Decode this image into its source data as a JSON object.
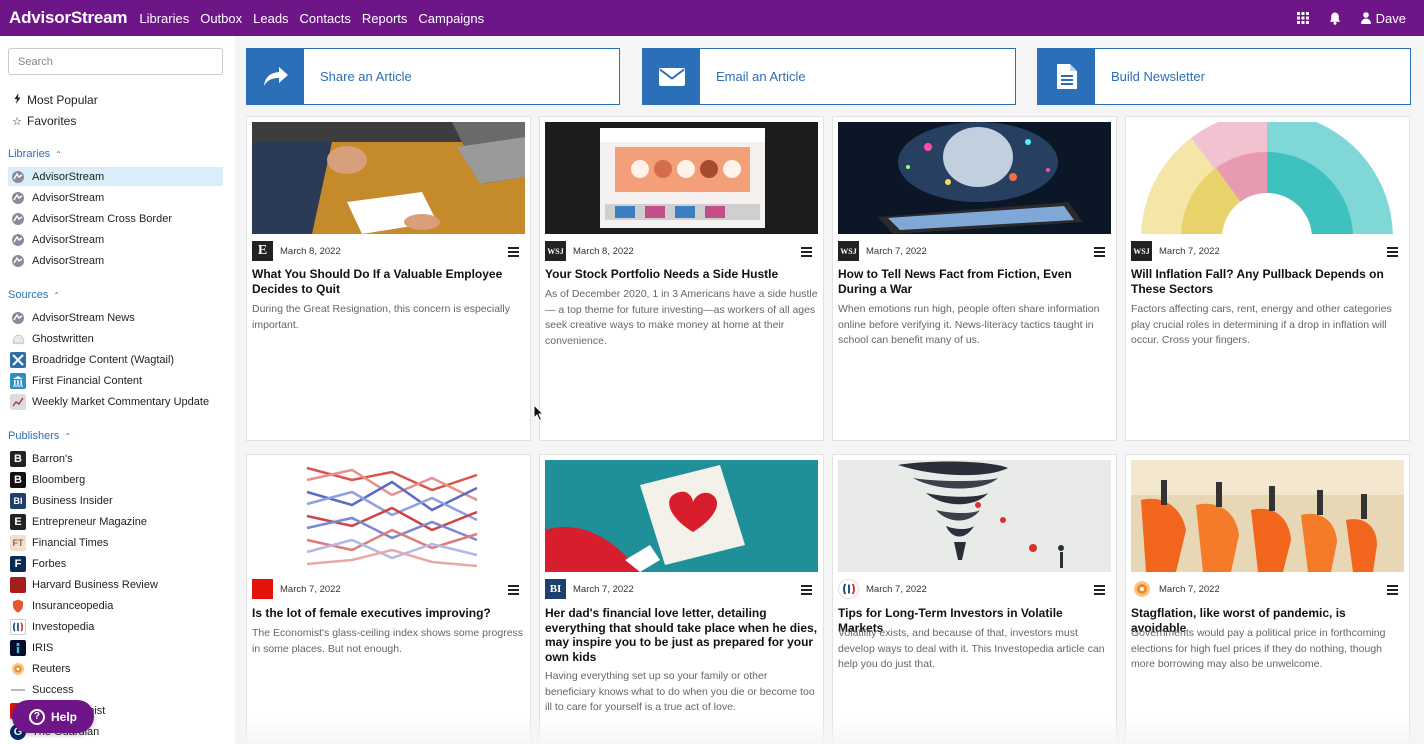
{
  "nav": {
    "brand": "AdvisorStream",
    "links": [
      "Libraries",
      "Outbox",
      "Leads",
      "Contacts",
      "Reports",
      "Campaigns"
    ],
    "user": "Dave"
  },
  "sidebar": {
    "search_placeholder": "Search",
    "quick": [
      {
        "label": "Most Popular",
        "icon": "bolt-icon"
      },
      {
        "label": "Favorites",
        "icon": "star-icon"
      }
    ],
    "libraries_label": "Libraries",
    "libraries": [
      {
        "label": "AdvisorStream",
        "active": true
      },
      {
        "label": "AdvisorStream"
      },
      {
        "label": "AdvisorStream Cross Border"
      },
      {
        "label": "AdvisorStream"
      },
      {
        "label": "AdvisorStream"
      }
    ],
    "sources_label": "Sources",
    "sources": [
      {
        "label": "AdvisorStream News",
        "icon": "advisorstream-logo-icon"
      },
      {
        "label": "Ghostwritten",
        "icon": "ghost-icon"
      },
      {
        "label": "Broadridge Content (Wagtail)",
        "icon": "broadridge-logo-icon"
      },
      {
        "label": "First Financial Content",
        "icon": "bank-icon"
      },
      {
        "label": "Weekly Market Commentary Update",
        "icon": "chart-icon"
      }
    ],
    "publishers_label": "Publishers",
    "publishers": [
      {
        "label": "Barron's",
        "glyph": "B",
        "color": "#222222"
      },
      {
        "label": "Bloomberg",
        "glyph": "B",
        "color": "#111111"
      },
      {
        "label": "Business Insider",
        "glyph": "BI",
        "color": "#1f3f6d"
      },
      {
        "label": "Entrepreneur Magazine",
        "glyph": "E",
        "color": "#222222"
      },
      {
        "label": "Financial Times",
        "glyph": "FT",
        "color": "#f2dfce"
      },
      {
        "label": "Forbes",
        "glyph": "F",
        "color": "#0b2a54"
      },
      {
        "label": "Harvard Business Review",
        "glyph": "",
        "color": "#a51d1d"
      },
      {
        "label": "Insuranceopedia",
        "glyph": "",
        "color": "#e4572e"
      },
      {
        "label": "Investopedia",
        "glyph": "I",
        "color": "#1a3d7a"
      },
      {
        "label": "IRIS",
        "glyph": "",
        "color": "#0a0a2a"
      },
      {
        "label": "Reuters",
        "glyph": "",
        "color": "#f08a24"
      },
      {
        "label": "Success",
        "glyph": "",
        "color": "#bbbbbb"
      },
      {
        "label": "The Economist",
        "glyph": "",
        "color": "#e3120b"
      },
      {
        "label": "The Guardian",
        "glyph": "G",
        "color": "#052962"
      }
    ],
    "help_label": "Help"
  },
  "actions": [
    {
      "label": "Share an Article",
      "icon": "share-arrow-icon"
    },
    {
      "label": "Email an Article",
      "icon": "envelope-icon"
    },
    {
      "label": "Build Newsletter",
      "icon": "document-icon"
    }
  ],
  "cards": [
    {
      "publisher_glyph": "E",
      "publisher_color": "#222222",
      "date": "March 8, 2022",
      "title": "What You Should Do If a Valuable Employee Decides to Quit",
      "desc": "During the Great Resignation, this concern is especially important.",
      "thumb": "desk-meeting-photo"
    },
    {
      "publisher_glyph": "WSJ",
      "publisher_color": "#222222",
      "date": "March 8, 2022",
      "title": "Your Stock Portfolio Needs a Side Hustle",
      "desc": "As of December 2020, 1 in 3 Americans have a side hustle — a top theme for future investing—as workers of all ages seek creative ways to make money at home at their convenience.",
      "thumb": "laptop-shop-photo"
    },
    {
      "publisher_glyph": "WSJ",
      "publisher_color": "#222222",
      "date": "March 7, 2022",
      "title": "How to Tell News Fact from Fiction, Even During a War",
      "desc": "When emotions run high, people often share information online before verifying it. News-literacy tactics taught in school can benefit many of us.",
      "thumb": "tablet-explosion-photo"
    },
    {
      "publisher_glyph": "WSJ",
      "publisher_color": "#222222",
      "date": "March 7, 2022",
      "title": "Will Inflation Fall? Any Pullback Depends on These Sectors",
      "desc": "Factors affecting cars, rent, energy and other categories play crucial roles in determining if a drop in inflation will occur. Cross your fingers.",
      "thumb": "sunburst-chart-image"
    },
    {
      "publisher_glyph": "",
      "publisher_color": "#e3120b",
      "date": "March 7, 2022",
      "title": "Is the lot of female executives improving?",
      "desc": "The Economist's glass-ceiling index shows some progress in some places. But not enough.",
      "thumb": "ranking-lines-image"
    },
    {
      "publisher_glyph": "BI",
      "publisher_color": "#1f3f6d",
      "date": "March 7, 2022",
      "title": "Her dad's financial love letter, detailing everything that should take place when he dies, may inspire you to be just as prepared for your own kids",
      "desc": "Having everything set up so your family or other beneficiary knows what to do when you die or become too ill to care for yourself is a true act of love.",
      "thumb": "heart-letter-photo"
    },
    {
      "publisher_glyph": "I",
      "publisher_color": "#ffffff",
      "date": "March 7, 2022",
      "title": "Tips for Long-Term Investors in Volatile Markets",
      "desc": "Volatility exists, and because of that, investors must develop ways to deal with it. This Investopedia article can help you do just that.",
      "thumb": "tornado-illustration"
    },
    {
      "publisher_glyph": "",
      "publisher_color": "#f08a24",
      "date": "March 7, 2022",
      "title": "Stagflation, like worst of pandemic, is avoidable",
      "desc": "Governments would pay a political price in forthcoming elections for high fuel prices if they do nothing, though more borrowing may also be unwelcome.",
      "thumb": "fuel-nozzles-photo"
    }
  ]
}
